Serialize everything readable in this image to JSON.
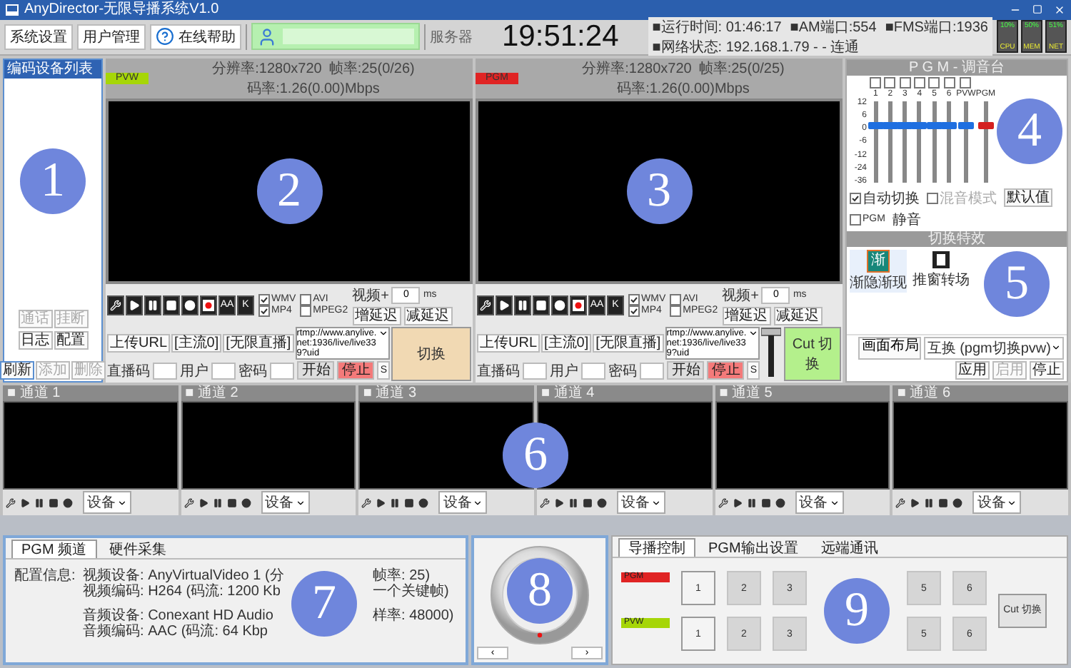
{
  "window": {
    "title": "AnyDirector-无限导播系统V1.0"
  },
  "toolbar": {
    "buttons": [
      "系统设置",
      "用户管理"
    ],
    "help": "在线帮助",
    "server": "服务器",
    "clock": "19:51:24",
    "status_lines": [
      [
        "■运行时间: 01:46:17",
        "■AM端口:554",
        "■FMS端口:1936"
      ],
      [
        "■网络状态: 192.168.1.79 - - 连通"
      ]
    ],
    "meters": [
      {
        "value": "10%",
        "label": "CPU"
      },
      {
        "value": "50%",
        "label": "MEM"
      },
      {
        "value": "51%",
        "label": "NET"
      }
    ]
  },
  "device_list": {
    "title": "编码设备列表",
    "marker": "1",
    "call_buttons": [
      {
        "label": "通话",
        "disabled": true
      },
      {
        "label": "挂断",
        "disabled": true
      }
    ],
    "buttons": [
      {
        "label": "日志",
        "disabled": false
      },
      {
        "label": "配置",
        "disabled": false
      }
    ],
    "footer_buttons": [
      {
        "label": "刷新",
        "disabled": false
      },
      {
        "label": "添加",
        "disabled": true
      },
      {
        "label": "删除",
        "disabled": true
      }
    ]
  },
  "monitors": [
    {
      "kind": "pvw",
      "tag": "PVW",
      "marker": "2",
      "stats": [
        "分辨率:1280x720",
        "帧率:25(0/26)",
        "码率:1.26(0.00)Mbps"
      ],
      "text_buttons": [
        "AA",
        "K"
      ],
      "formats": [
        {
          "label": "WMV",
          "checked": true
        },
        {
          "label": "AVI",
          "checked": false
        },
        {
          "label": "MP4",
          "checked": true
        },
        {
          "label": "MPEG2",
          "checked": false
        }
      ],
      "delay_label": "视频+",
      "delay_value": "0",
      "delay_unit": "ms",
      "delay_buttons": [
        "增延迟",
        "减延迟"
      ],
      "upload_label": "上传URL",
      "stream_tags": [
        "[主流0]",
        "[无限直播]"
      ],
      "url": "rtmp://www.anylive.net:1936/live/live339?uid",
      "code_label": "直播码",
      "user_label": "用户",
      "password_label": "密码",
      "start": "开始",
      "stop": "停止",
      "extra": "S",
      "switch": "切换"
    },
    {
      "kind": "pgm",
      "tag": "PGM",
      "marker": "3",
      "stats": [
        "分辨率:1280x720",
        "帧率:25(0/25)",
        "码率:1.26(0.00)Mbps"
      ],
      "text_buttons": [
        "AA",
        "K"
      ],
      "formats": [
        {
          "label": "WMV",
          "checked": true
        },
        {
          "label": "AVI",
          "checked": false
        },
        {
          "label": "MP4",
          "checked": true
        },
        {
          "label": "MPEG2",
          "checked": false
        }
      ],
      "delay_label": "视频+",
      "delay_value": "0",
      "delay_unit": "ms",
      "delay_buttons": [
        "增延迟",
        "减延迟"
      ],
      "upload_label": "上传URL",
      "stream_tags": [
        "[主流0]",
        "[无限直播]"
      ],
      "url": "rtmp://www.anylive.net:1936/live/live339?uid",
      "code_label": "直播码",
      "user_label": "用户",
      "password_label": "密码",
      "start": "开始",
      "stop": "停止",
      "extra": "S",
      "switch": "Cut 切换"
    }
  ],
  "mixer": {
    "title": "P G M - 调音台",
    "marker": "4",
    "scale": [
      "12",
      "6",
      "0",
      "-6",
      "-12",
      "-24",
      "-36"
    ],
    "channels": [
      {
        "kind": "input",
        "label": "1",
        "checked": false,
        "level": 0.7
      },
      {
        "kind": "input",
        "label": "2",
        "checked": false,
        "level": 0.7
      },
      {
        "kind": "input",
        "label": "3",
        "checked": false,
        "level": 0.7
      },
      {
        "kind": "input",
        "label": "4",
        "checked": false,
        "level": 0.7
      },
      {
        "kind": "input",
        "label": "5",
        "checked": false,
        "level": 0.7
      },
      {
        "kind": "input",
        "label": "6",
        "checked": false,
        "level": 0.7
      },
      {
        "kind": "input",
        "label": "PVW",
        "checked": false,
        "level": 0.7
      },
      {
        "kind": "master",
        "label": "PGM",
        "level": 0.7
      }
    ],
    "auto_switch": {
      "label": "自动切换",
      "checked": true
    },
    "mix_mode": {
      "label": "混音模式",
      "checked": false,
      "disabled": true
    },
    "default_button": "默认值",
    "pgm_mute": {
      "label": "PGM",
      "checked": false
    },
    "mute_label": "静音"
  },
  "transitions": {
    "title": "切换特效",
    "marker": "5",
    "items": [
      {
        "kind": "glyph",
        "glyph": "渐",
        "label": "渐隐渐现",
        "selected": true
      },
      {
        "kind": "film",
        "label": "推窗转场",
        "selected": false
      }
    ],
    "layout_label": "画面布局",
    "layout_value": "互换 (pgm切换pvw)",
    "buttons": [
      {
        "label": "应用",
        "disabled": false
      },
      {
        "label": "启用",
        "disabled": true
      },
      {
        "label": "停止",
        "disabled": false
      }
    ]
  },
  "channels_marker": "6",
  "channels": [
    {
      "title": "■ 通道 1",
      "device": "设备"
    },
    {
      "title": "■ 通道 2",
      "device": "设备"
    },
    {
      "title": "■ 通道 3",
      "device": "设备"
    },
    {
      "title": "■ 通道 4",
      "device": "设备"
    },
    {
      "title": "■ 通道 5",
      "device": "设备"
    },
    {
      "title": "■ 通道 6",
      "device": "设备"
    }
  ],
  "config_panel": {
    "marker": "7",
    "tabs": [
      {
        "label": "PGM 频道",
        "selected": true
      },
      {
        "label": "硬件采集",
        "selected": false
      }
    ],
    "label": "配置信息:",
    "groups": [
      [
        {
          "left": "视频设备: AnyVirtualVideo 1 (分",
          "right": "帧率: 25)"
        },
        {
          "left": "视频编码: H264 (码流: 1200 Kb",
          "right": "一个关键帧)"
        }
      ],
      [
        {
          "left": "音频设备: Conexant HD Audio",
          "right": "样率: 48000)"
        },
        {
          "left": "音频编码: AAC (码流: 64 Kbp"
        }
      ]
    ]
  },
  "knob": {
    "marker": "8",
    "buttons": [
      "‹",
      "›"
    ]
  },
  "director": {
    "marker": "9",
    "tabs": [
      {
        "label": "导播控制",
        "selected": true
      },
      {
        "label": "PGM输出设置",
        "selected": false
      },
      {
        "label": "远端通讯",
        "selected": false
      }
    ],
    "rows": [
      {
        "kind": "pgm",
        "tag": "PGM",
        "buttons": [
          {
            "label": "1",
            "selected": true
          },
          {
            "label": "2",
            "selected": false
          },
          {
            "label": "3",
            "selected": false
          },
          {
            "label": "5",
            "selected": false
          },
          {
            "label": "6",
            "selected": false
          }
        ]
      },
      {
        "kind": "pvw",
        "tag": "PVW",
        "buttons": [
          {
            "label": "1",
            "selected": true
          },
          {
            "label": "2",
            "selected": false
          },
          {
            "label": "3",
            "selected": false
          },
          {
            "label": "5",
            "selected": false
          },
          {
            "label": "6",
            "selected": false
          }
        ]
      }
    ],
    "cut": "Cut 切换"
  }
}
